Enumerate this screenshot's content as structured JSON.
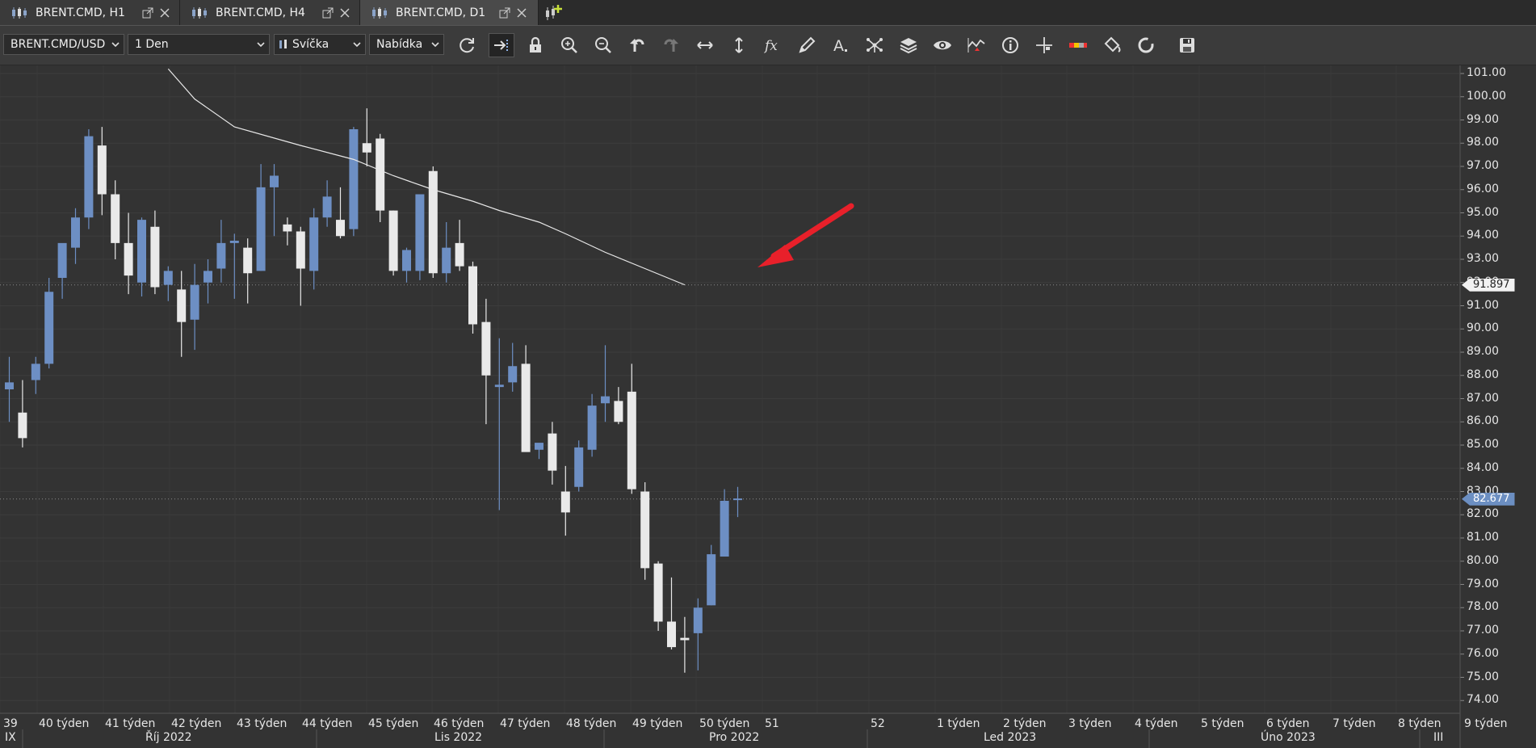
{
  "tabs": [
    {
      "label": "BRENT.CMD, H1",
      "active": false
    },
    {
      "label": "BRENT.CMD, H4",
      "active": false
    },
    {
      "label": "BRENT.CMD, D1",
      "active": true
    }
  ],
  "toolbar": {
    "instrument": "BRENT.CMD/USD",
    "period": "1 Den",
    "chart_type": "Svíčka",
    "price_side": "Nabídka",
    "icons": [
      "refresh-icon",
      "shift-chart-icon",
      "lock-icon",
      "zoom-in-icon",
      "zoom-out-icon",
      "undo-icon",
      "redo-icon",
      "horizontal-resize-icon",
      "vertical-resize-icon",
      "indicators-fx-icon",
      "draw-pencil-icon",
      "text-tool-icon",
      "patterns-icon",
      "layers-icon",
      "eye-icon",
      "signals-icon",
      "info-icon",
      "crosshair-icon",
      "color-theme-icon",
      "paint-bucket-icon",
      "reset-icon",
      "save-icon"
    ]
  },
  "chart_data": {
    "type": "candlestick",
    "ylim": [
      73.5,
      101.5
    ],
    "y_ticks": [
      "101.00",
      "100.00",
      "99.00",
      "98.00",
      "97.00",
      "96.00",
      "95.00",
      "94.00",
      "93.00",
      "92.00",
      "91.00",
      "90.00",
      "89.00",
      "88.00",
      "87.00",
      "86.00",
      "85.00",
      "84.00",
      "83.00",
      "82.00",
      "81.00",
      "80.00",
      "79.00",
      "78.00",
      "77.00",
      "76.00",
      "75.00",
      "74.00"
    ],
    "price_labels": {
      "moving_average": "91.897",
      "current": "82.677"
    },
    "week_labels": [
      "39",
      "40 týden",
      "41 týden",
      "42 týden",
      "43 týden",
      "44 týden",
      "45 týden",
      "46 týden",
      "47 týden",
      "48 týden",
      "49 týden",
      "50 týden",
      "51",
      "52",
      "1 týden",
      "2 týden",
      "3 týden",
      "4 týden",
      "5 týden",
      "6 týden",
      "7 týden",
      "8 týden",
      "9 týden"
    ],
    "month_labels": [
      "IX",
      "Říj 2022",
      "Lis 2022",
      "Pro 2022",
      "Led 2023",
      "Úno 2023",
      "III"
    ],
    "candles": [
      {
        "o": 87.4,
        "h": 88.8,
        "l": 86.0,
        "c": 87.7
      },
      {
        "o": 86.4,
        "h": 87.8,
        "l": 84.9,
        "c": 85.3
      },
      {
        "o": 87.8,
        "h": 88.8,
        "l": 87.2,
        "c": 88.5
      },
      {
        "o": 88.5,
        "h": 92.2,
        "l": 88.3,
        "c": 91.6
      },
      {
        "o": 92.2,
        "h": 93.4,
        "l": 91.3,
        "c": 93.7
      },
      {
        "o": 93.5,
        "h": 95.2,
        "l": 92.8,
        "c": 94.8
      },
      {
        "o": 94.8,
        "h": 98.6,
        "l": 94.3,
        "c": 98.3
      },
      {
        "o": 97.9,
        "h": 98.7,
        "l": 94.9,
        "c": 95.8
      },
      {
        "o": 95.8,
        "h": 96.4,
        "l": 93.0,
        "c": 93.7
      },
      {
        "o": 93.7,
        "h": 95.0,
        "l": 91.5,
        "c": 92.3
      },
      {
        "o": 92.0,
        "h": 94.8,
        "l": 91.4,
        "c": 94.7
      },
      {
        "o": 94.4,
        "h": 95.1,
        "l": 91.5,
        "c": 91.8
      },
      {
        "o": 91.9,
        "h": 92.7,
        "l": 91.2,
        "c": 92.5
      },
      {
        "o": 91.7,
        "h": 92.5,
        "l": 88.8,
        "c": 90.3
      },
      {
        "o": 90.4,
        "h": 92.8,
        "l": 89.1,
        "c": 91.9
      },
      {
        "o": 92.0,
        "h": 93.0,
        "l": 91.1,
        "c": 92.5
      },
      {
        "o": 92.6,
        "h": 94.7,
        "l": 92.0,
        "c": 93.7
      },
      {
        "o": 93.7,
        "h": 94.1,
        "l": 91.3,
        "c": 93.8
      },
      {
        "o": 93.5,
        "h": 93.9,
        "l": 91.1,
        "c": 92.4
      },
      {
        "o": 92.5,
        "h": 97.1,
        "l": 92.5,
        "c": 96.1
      },
      {
        "o": 96.1,
        "h": 97.1,
        "l": 94.0,
        "c": 96.6
      },
      {
        "o": 94.5,
        "h": 94.8,
        "l": 93.6,
        "c": 94.2
      },
      {
        "o": 94.2,
        "h": 94.4,
        "l": 91.0,
        "c": 92.6
      },
      {
        "o": 92.5,
        "h": 95.2,
        "l": 91.7,
        "c": 94.8
      },
      {
        "o": 94.8,
        "h": 96.4,
        "l": 94.4,
        "c": 95.7
      },
      {
        "o": 94.7,
        "h": 96.1,
        "l": 93.9,
        "c": 94.0
      },
      {
        "o": 94.3,
        "h": 98.7,
        "l": 94.0,
        "c": 98.6
      },
      {
        "o": 98.0,
        "h": 99.5,
        "l": 97.0,
        "c": 97.6
      },
      {
        "o": 98.2,
        "h": 98.4,
        "l": 94.6,
        "c": 95.1
      },
      {
        "o": 95.1,
        "h": 95.1,
        "l": 92.3,
        "c": 92.5
      },
      {
        "o": 92.5,
        "h": 93.5,
        "l": 92.0,
        "c": 93.4
      },
      {
        "o": 92.5,
        "h": 93.8,
        "l": 92.1,
        "c": 95.8
      },
      {
        "o": 96.8,
        "h": 97.0,
        "l": 92.2,
        "c": 92.4
      },
      {
        "o": 92.4,
        "h": 94.6,
        "l": 92.0,
        "c": 93.5
      },
      {
        "o": 93.7,
        "h": 94.7,
        "l": 92.5,
        "c": 92.7
      },
      {
        "o": 92.7,
        "h": 92.9,
        "l": 89.8,
        "c": 90.2
      },
      {
        "o": 90.3,
        "h": 91.3,
        "l": 85.9,
        "c": 88.0
      },
      {
        "o": 87.5,
        "h": 89.6,
        "l": 82.2,
        "c": 87.6
      },
      {
        "o": 87.7,
        "h": 89.4,
        "l": 87.3,
        "c": 88.4
      },
      {
        "o": 88.5,
        "h": 89.3,
        "l": 84.9,
        "c": 84.7
      },
      {
        "o": 84.8,
        "h": 84.9,
        "l": 84.4,
        "c": 85.1
      },
      {
        "o": 85.5,
        "h": 86.0,
        "l": 83.3,
        "c": 83.9
      },
      {
        "o": 83.0,
        "h": 84.1,
        "l": 81.1,
        "c": 82.1
      },
      {
        "o": 83.2,
        "h": 85.2,
        "l": 83.0,
        "c": 84.9
      },
      {
        "o": 84.8,
        "h": 87.2,
        "l": 84.5,
        "c": 86.7
      },
      {
        "o": 86.8,
        "h": 89.3,
        "l": 86.0,
        "c": 87.1
      },
      {
        "o": 86.9,
        "h": 87.5,
        "l": 85.9,
        "c": 86.0
      },
      {
        "o": 87.3,
        "h": 88.5,
        "l": 82.9,
        "c": 83.1
      },
      {
        "o": 83.0,
        "h": 83.4,
        "l": 79.2,
        "c": 79.7
      },
      {
        "o": 79.9,
        "h": 80.0,
        "l": 77.0,
        "c": 77.4
      },
      {
        "o": 77.4,
        "h": 79.3,
        "l": 76.2,
        "c": 76.3
      },
      {
        "o": 76.7,
        "h": 77.6,
        "l": 75.2,
        "c": 76.6
      },
      {
        "o": 76.9,
        "h": 78.4,
        "l": 75.3,
        "c": 78.0
      },
      {
        "o": 78.1,
        "h": 80.7,
        "l": 78.1,
        "c": 80.3
      },
      {
        "o": 80.2,
        "h": 83.1,
        "l": 80.2,
        "c": 82.6
      },
      {
        "o": 82.7,
        "h": 83.2,
        "l": 81.9,
        "c": 82.7
      }
    ],
    "ma_line": [
      [
        12,
        101.2
      ],
      [
        14,
        99.9
      ],
      [
        17,
        98.7
      ],
      [
        22,
        97.9
      ],
      [
        26,
        97.3
      ],
      [
        29,
        96.6
      ],
      [
        32,
        96.0
      ],
      [
        35,
        95.5
      ],
      [
        37,
        95.1
      ],
      [
        40,
        94.6
      ],
      [
        42,
        94.1
      ],
      [
        45,
        93.3
      ],
      [
        48,
        92.6
      ],
      [
        51,
        91.9
      ]
    ]
  }
}
